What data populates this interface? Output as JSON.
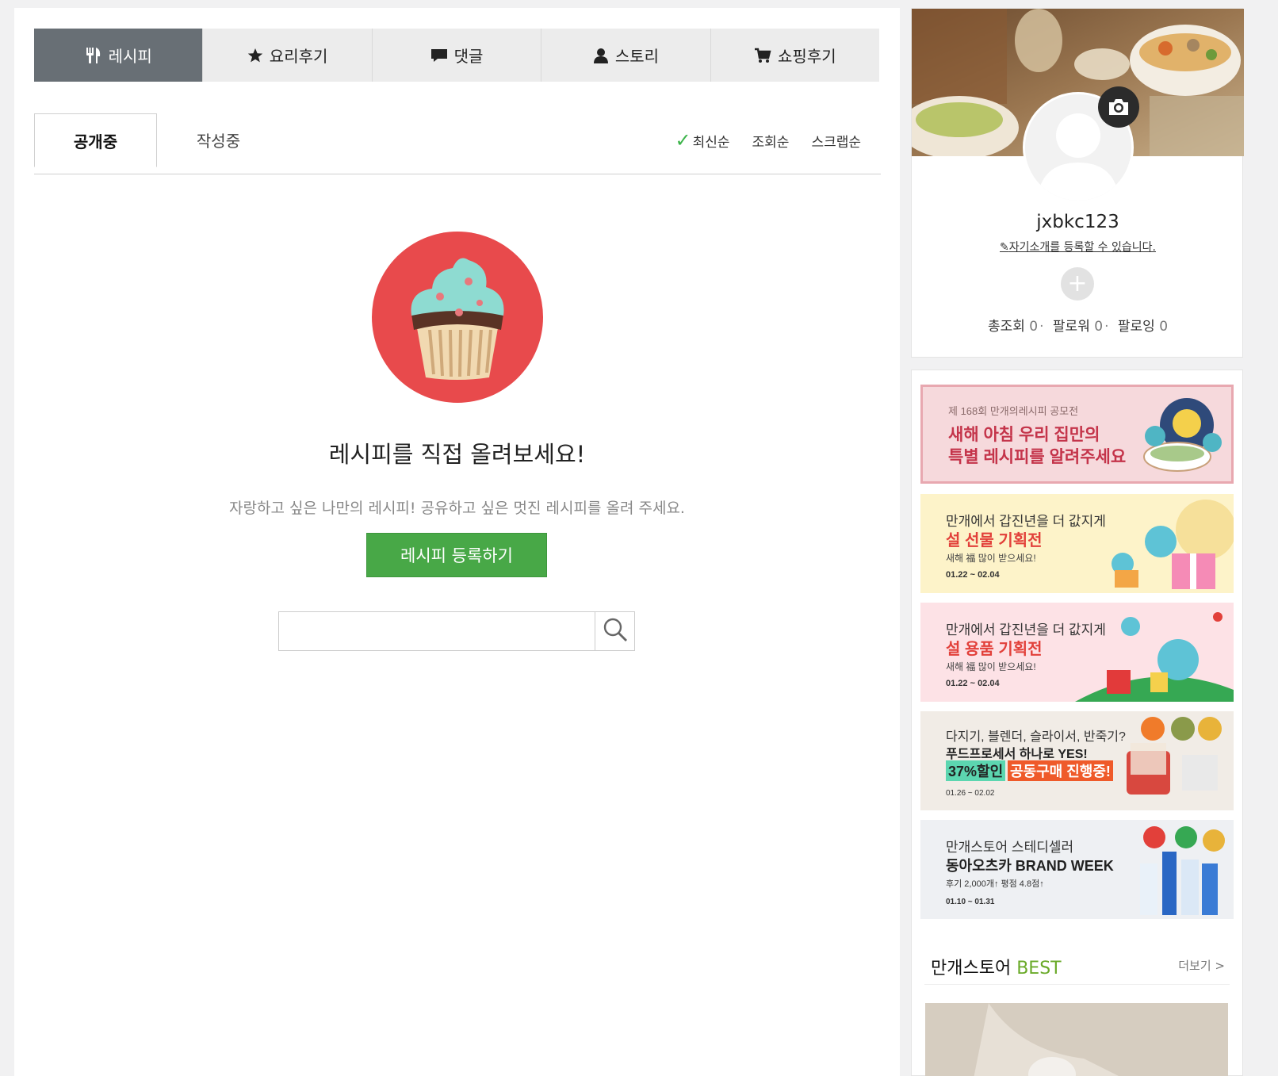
{
  "tabs": [
    {
      "label": "레시피",
      "icon": "utensils-icon"
    },
    {
      "label": "요리후기",
      "icon": "star-icon"
    },
    {
      "label": "댓글",
      "icon": "comment-icon"
    },
    {
      "label": "스토리",
      "icon": "user-icon"
    },
    {
      "label": "쇼핑후기",
      "icon": "cart-icon"
    }
  ],
  "subtabs": {
    "public": "공개중",
    "draft": "작성중"
  },
  "sort": {
    "latest": "최신순",
    "views": "조회순",
    "scraps": "스크랩순"
  },
  "empty": {
    "title": "레시피를 직접 올려보세요!",
    "subtitle": "자랑하고 싶은 나만의 레시피! 공유하고 싶은 멋진 레시피를 올려 주세요.",
    "button": "레시피 등록하기"
  },
  "search": {
    "value": "",
    "placeholder": ""
  },
  "profile": {
    "username": "jxbkc123",
    "intro_link": "자기소개를 등록할 수 있습니다.",
    "stats": {
      "views_label": "총조회",
      "views": "0",
      "followers_label": "팔로워",
      "followers": "0",
      "following_label": "팔로잉",
      "following": "0"
    }
  },
  "banners": [
    {
      "line1": "제 168회 만개의레시피 공모전",
      "line2": "새해 아침 우리 집만의",
      "line3": "특별 레시피를 알려주세요"
    },
    {
      "line1": "만개에서 갑진년을 더 값지게",
      "line2": "설 선물 기획전",
      "line3": "새해 福 많이 받으세요!",
      "date": "01.22 ~ 02.04"
    },
    {
      "line1": "만개에서 갑진년을 더 값지게",
      "line2": "설 용품 기획전",
      "line3": "새해 福 많이 받으세요!",
      "date": "01.22 ~ 02.04"
    },
    {
      "line1": "다지기, 블렌더, 슬라이서, 반죽기?",
      "line2": "푸드프로세서 하나로 YES!",
      "line3": "37%할인",
      "line4": "공동구매 진행중!",
      "date": "01.26 ~ 02.02"
    },
    {
      "line1": "만개스토어 스테디셀러",
      "line2": "동아오츠카 BRAND WEEK",
      "line3": "후기 2,000개↑ 평점 4.8점↑",
      "date": "01.10 ~ 01.31"
    }
  ],
  "best": {
    "title_prefix": "만개스토어 ",
    "title_highlight": "BEST",
    "more": "더보기 >"
  }
}
